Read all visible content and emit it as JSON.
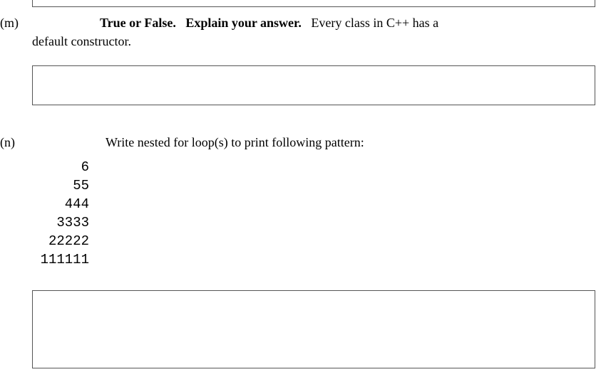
{
  "question_m": {
    "label": "(m)",
    "bold_part1": "True or False.",
    "bold_part2": "Explain your answer.",
    "text_part1": "Every class in C++ has a",
    "text_part2": "default constructor."
  },
  "question_n": {
    "label": "(n)",
    "text": "Write nested for loop(s) to print following pattern:"
  },
  "pattern": {
    "lines": [
      "6",
      "55",
      "444",
      "3333",
      "22222",
      "111111"
    ]
  }
}
